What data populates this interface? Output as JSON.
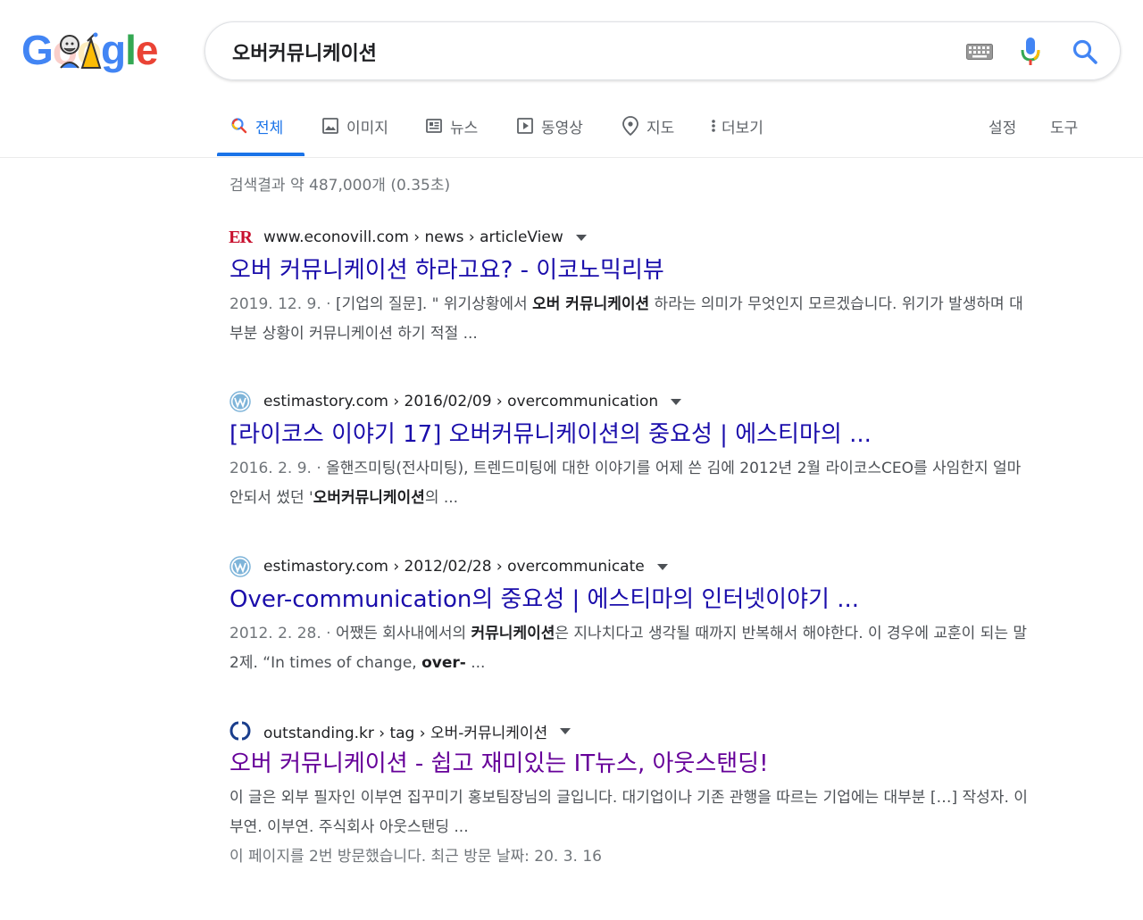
{
  "logo": {
    "letters": [
      "G",
      "o",
      "o",
      "g",
      "l",
      "e"
    ],
    "colors": [
      "#4285f4",
      "#ea4335",
      "#fbbc05",
      "#4285f4",
      "#34a853",
      "#ea4335"
    ]
  },
  "search": {
    "query": "오버커뮤니케이션"
  },
  "icons": {
    "keyboard": "keyboard-icon",
    "mic": "mic-icon",
    "search": "search-icon"
  },
  "tabs": [
    {
      "label": "전체",
      "icon": "search-icon",
      "active": true
    },
    {
      "label": "이미지",
      "icon": "image-icon"
    },
    {
      "label": "뉴스",
      "icon": "news-icon"
    },
    {
      "label": "동영상",
      "icon": "video-icon"
    },
    {
      "label": "지도",
      "icon": "map-pin-icon"
    },
    {
      "label": "더보기",
      "icon": "more-vert-icon"
    }
  ],
  "tools": {
    "settings": "설정",
    "tools": "도구"
  },
  "stats": "검색결과 약 487,000개 (0.35초)",
  "results": [
    {
      "favicon_text": "ER",
      "cite": "www.econovill.com › news › articleView",
      "title": "오버 커뮤니케이션 하라고요? - 이코노믹리뷰",
      "date": "2019. 12. 9. · ",
      "s1": "[기업의 질문]. \" 위기상황에서 ",
      "b1": "오버 커뮤니케이션",
      "s2": " 하라는 의미가 무엇인지 모르겠습니다. 위기가 발생하며 대부분 상황이 커뮤니케이션 하기 적절 ..."
    },
    {
      "cite": "estimastory.com › 2016/02/09 › overcommunication",
      "title": "[라이코스 이야기 17] 오버커뮤니케이션의 중요성 | 에스티마의 ...",
      "date": "2016. 2. 9. · ",
      "s1": "올핸즈미팅(전사미팅), 트렌드미팅에 대한 이야기를 어제 쓴 김에 2012년 2월 라이코스CEO를 사임한지 얼마 안되서 썼던 '",
      "b1": "오버커뮤니케이션",
      "s2": "의 ..."
    },
    {
      "cite": "estimastory.com › 2012/02/28 › overcommunicate",
      "title": "Over-communication의 중요성 | 에스티마의 인터넷이야기 ...",
      "date": "2012. 2. 28. · ",
      "s1": "어쨌든 회사내에서의 ",
      "b1": "커뮤니케이션",
      "s2": "은 지나치다고 생각될 때까지 반복해서 해야한다. 이 경우에 교훈이 되는 말 2제. “In times of change, ",
      "b2": "over-",
      "s3": " ..."
    },
    {
      "cite": "outstanding.kr › tag › 오버-커뮤니케이션",
      "title": "오버 커뮤니케이션 - 쉽고 재미있는 IT뉴스, 아웃스탠딩!",
      "s1": "이 글은 외부 필자인 이부연 집꾸미기 홍보팀장님의 글입니다. 대기업이나 기존 관행을 따르는 기업에는 대부분 […] 작성자. 이부연. 이부연. 주식회사 아웃스탠딩 ...",
      "visit": "이 페이지를 2번 방문했습니다. 최근 방문 날짜: 20. 3. 16"
    }
  ]
}
